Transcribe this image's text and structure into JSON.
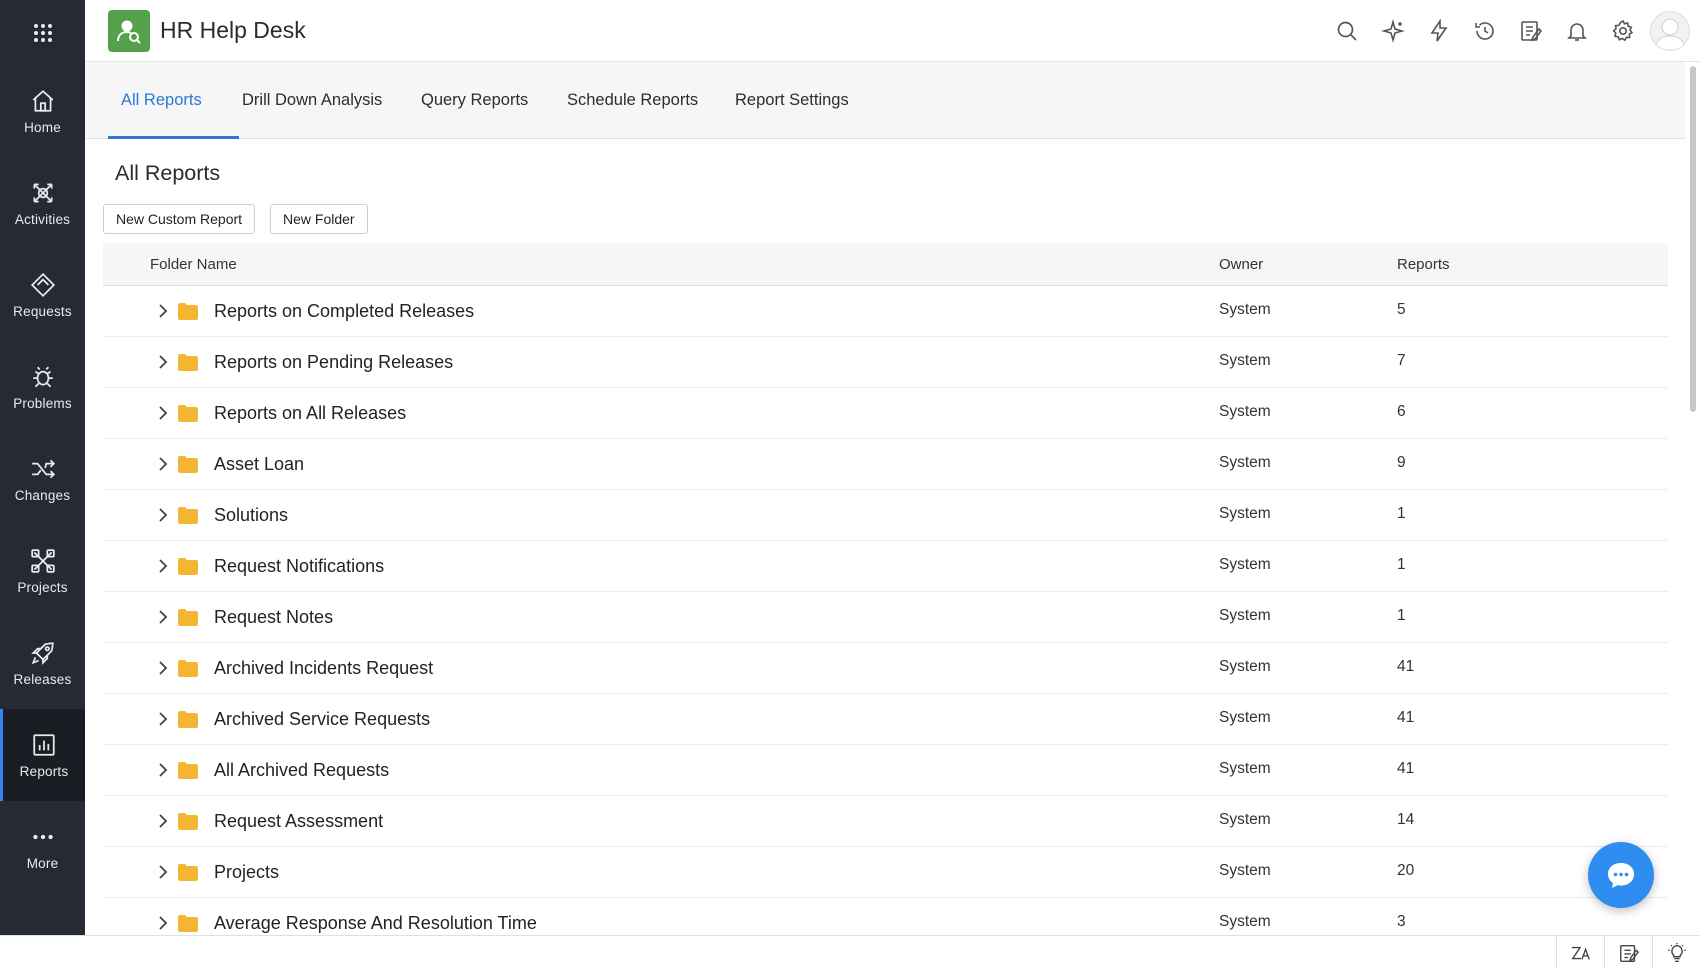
{
  "app": {
    "title": "HR Help Desk"
  },
  "sidebar": {
    "items": [
      {
        "label": "Home",
        "icon": "home-icon"
      },
      {
        "label": "Activities",
        "icon": "activities-icon"
      },
      {
        "label": "Requests",
        "icon": "requests-icon"
      },
      {
        "label": "Problems",
        "icon": "problems-icon"
      },
      {
        "label": "Changes",
        "icon": "changes-icon"
      },
      {
        "label": "Projects",
        "icon": "projects-icon"
      },
      {
        "label": "Releases",
        "icon": "releases-icon"
      },
      {
        "label": "Reports",
        "icon": "reports-icon",
        "active": true
      },
      {
        "label": "More",
        "icon": "more-icon"
      }
    ]
  },
  "header_icons": [
    "search-icon",
    "ai-sparkle-icon",
    "lightning-icon",
    "history-icon",
    "notes-icon",
    "bell-icon",
    "gear-icon",
    "avatar"
  ],
  "tabs": [
    {
      "label": "All Reports",
      "active": true
    },
    {
      "label": "Drill Down Analysis"
    },
    {
      "label": "Query Reports"
    },
    {
      "label": "Schedule Reports"
    },
    {
      "label": "Report Settings"
    }
  ],
  "main": {
    "title": "All Reports",
    "buttons": {
      "new_custom_report": "New Custom Report",
      "new_folder": "New Folder"
    },
    "columns": {
      "folder_name": "Folder Name",
      "owner": "Owner",
      "reports": "Reports"
    },
    "rows": [
      {
        "name": "Reports on Completed Releases",
        "owner": "System",
        "reports": "5"
      },
      {
        "name": "Reports on Pending Releases",
        "owner": "System",
        "reports": "7"
      },
      {
        "name": "Reports on All Releases",
        "owner": "System",
        "reports": "6"
      },
      {
        "name": "Asset Loan",
        "owner": "System",
        "reports": "9"
      },
      {
        "name": "Solutions",
        "owner": "System",
        "reports": "1"
      },
      {
        "name": "Request Notifications",
        "owner": "System",
        "reports": "1"
      },
      {
        "name": "Request Notes",
        "owner": "System",
        "reports": "1"
      },
      {
        "name": "Archived Incidents Request",
        "owner": "System",
        "reports": "41"
      },
      {
        "name": "Archived Service Requests",
        "owner": "System",
        "reports": "41"
      },
      {
        "name": "All Archived Requests",
        "owner": "System",
        "reports": "41"
      },
      {
        "name": "Request Assessment",
        "owner": "System",
        "reports": "14"
      },
      {
        "name": "Projects",
        "owner": "System",
        "reports": "20"
      },
      {
        "name": "Average Response And Resolution Time",
        "owner": "System",
        "reports": "3"
      }
    ]
  },
  "colors": {
    "sidebar_bg": "#262a33",
    "accent": "#2b7ad6",
    "logo_green": "#55a04a",
    "folder_yellow": "#f4b632",
    "chat_blue": "#2f8cf0"
  },
  "bottom_icons": [
    "translate-icon",
    "notes-icon",
    "lightbulb-icon"
  ]
}
